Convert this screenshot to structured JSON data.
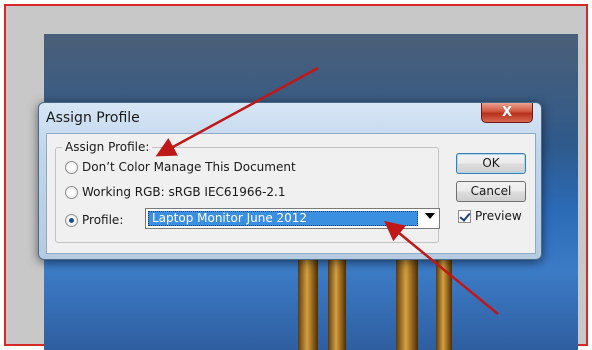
{
  "dialog": {
    "title": "Assign Profile",
    "close_label": "X",
    "group_label": "Assign Profile:",
    "options": [
      {
        "label": "Don’t Color Manage This Document",
        "selected": false
      },
      {
        "label": "Working RGB:  sRGB IEC61966-2.1",
        "selected": false
      },
      {
        "label": "Profile:",
        "selected": true
      }
    ],
    "profile_select": {
      "value": "Laptop Monitor June 2012"
    },
    "buttons": {
      "ok": "OK",
      "cancel": "Cancel"
    },
    "preview": {
      "label": "Preview",
      "checked": true
    }
  },
  "colors": {
    "frame_border": "#d62a2a",
    "annotation_arrow": "#c01818",
    "selection_highlight": "#3b8fe0"
  }
}
